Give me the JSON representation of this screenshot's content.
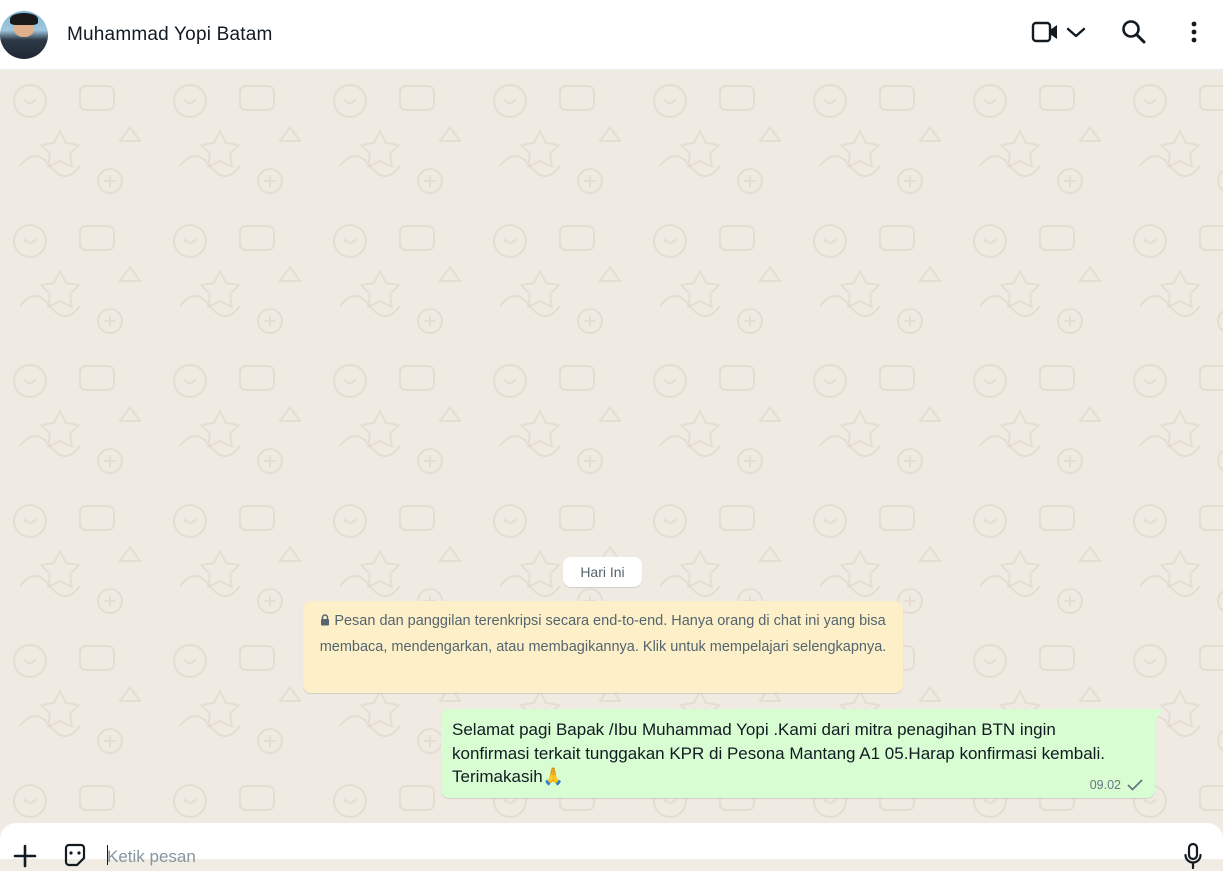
{
  "header": {
    "contact_name": "Muhammad Yopi Batam",
    "icons": [
      "video-call-icon",
      "chevron-down-icon",
      "search-icon",
      "menu-icon"
    ]
  },
  "chat": {
    "date_label": "Hari Ini",
    "encryption_notice": "Pesan dan panggilan terenkripsi secara end-to-end. Hanya orang di chat ini yang bisa membaca, mendengarkan, atau membagikannya. Klik untuk mempelajari selengkapnya.",
    "messages": [
      {
        "direction": "outgoing",
        "text": "Selamat pagi Bapak /Ibu Muhammad Yopi .Kami dari mitra penagihan BTN ingin konfirmasi terkait tunggakan KPR di Pesona Mantang A1 05.Harap konfirmasi kembali. Terimakasih🙏",
        "time": "09.02",
        "status": "sent"
      }
    ]
  },
  "composer": {
    "placeholder": "Ketik pesan",
    "icons": [
      "plus-icon",
      "sticker-icon",
      "mic-icon"
    ]
  },
  "colors": {
    "header_bg": "#ffffff",
    "chat_bg": "#efeae2",
    "outgoing_bubble": "#d9fdd3",
    "notice_bg": "#fdf0c9",
    "text_primary": "#111b21",
    "text_secondary": "#54656f"
  }
}
